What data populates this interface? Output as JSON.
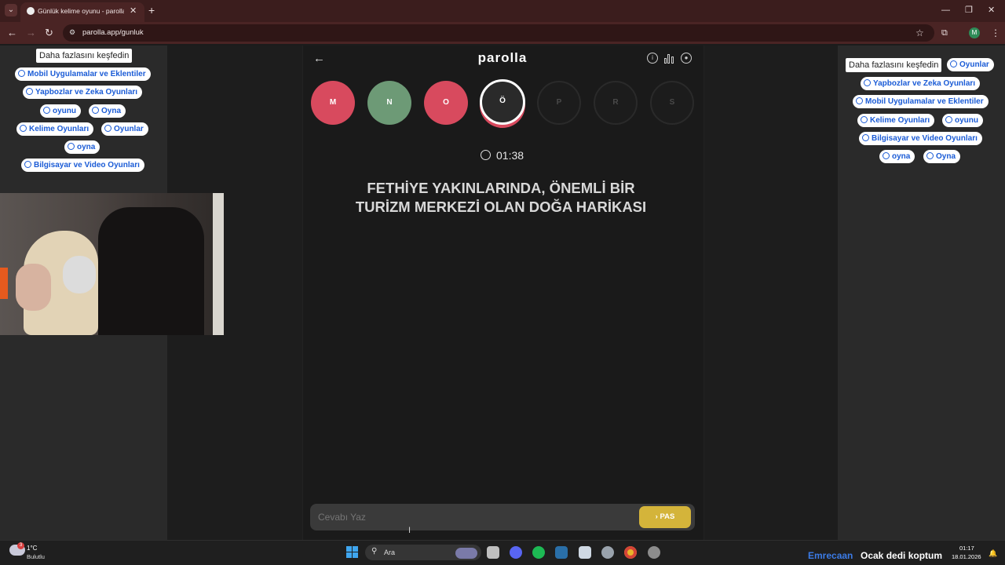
{
  "browser": {
    "tab_title": "Günlük kelime oyunu - parolla",
    "url": "parolla.app/gunluk",
    "profile_initial": "M"
  },
  "ads": {
    "left_discover": "Daha fazlasını keşfedin",
    "left_chips": [
      "Mobil Uygulamalar ve Eklentiler",
      "Yapbozlar ve Zeka Oyunları",
      "oyunu",
      "Oyna",
      "Kelime Oyunları",
      "Oyunlar",
      "oyna",
      "Bilgisayar ve Video Oyunları"
    ],
    "right_discover": "Daha fazlasını keşfedin",
    "right_chips": [
      "Oyunlar",
      "Yapbozlar ve Zeka Oyunları",
      "Mobil Uygulamalar ve Eklentiler",
      "Kelime Oyunları",
      "oyunu",
      "Bilgisayar ve Video Oyunları",
      "oyna",
      "Oyna"
    ]
  },
  "game": {
    "logo": "parolla",
    "letters": [
      {
        "letter": "M",
        "state": "wrong"
      },
      {
        "letter": "N",
        "state": "correct"
      },
      {
        "letter": "O",
        "state": "wrong"
      },
      {
        "letter": "Ö",
        "state": "current"
      },
      {
        "letter": "P",
        "state": "pending"
      },
      {
        "letter": "R",
        "state": "pending"
      },
      {
        "letter": "S",
        "state": "pending"
      }
    ],
    "timer": "01:38",
    "question": "FETHİYE YAKINLARINDA, ÖNEMLİ BİR TURİZM MERKEZİ OLAN DOĞA HARİKASI",
    "answer_placeholder": "Cevabı Yaz",
    "pass_label": "PAS",
    "colors": {
      "wrong": "#d84a5e",
      "correct": "#6d9a76",
      "pass": "#d4b43a"
    }
  },
  "taskbar": {
    "weather_badge": "3",
    "weather_temp": "1°C",
    "weather_desc": "Bulutlu",
    "search_text": "Ara",
    "now_playing_user": "Emrecaan",
    "now_playing_song": "Ocak dedi koptum",
    "time": "01:17",
    "date": "18.01.2026"
  }
}
